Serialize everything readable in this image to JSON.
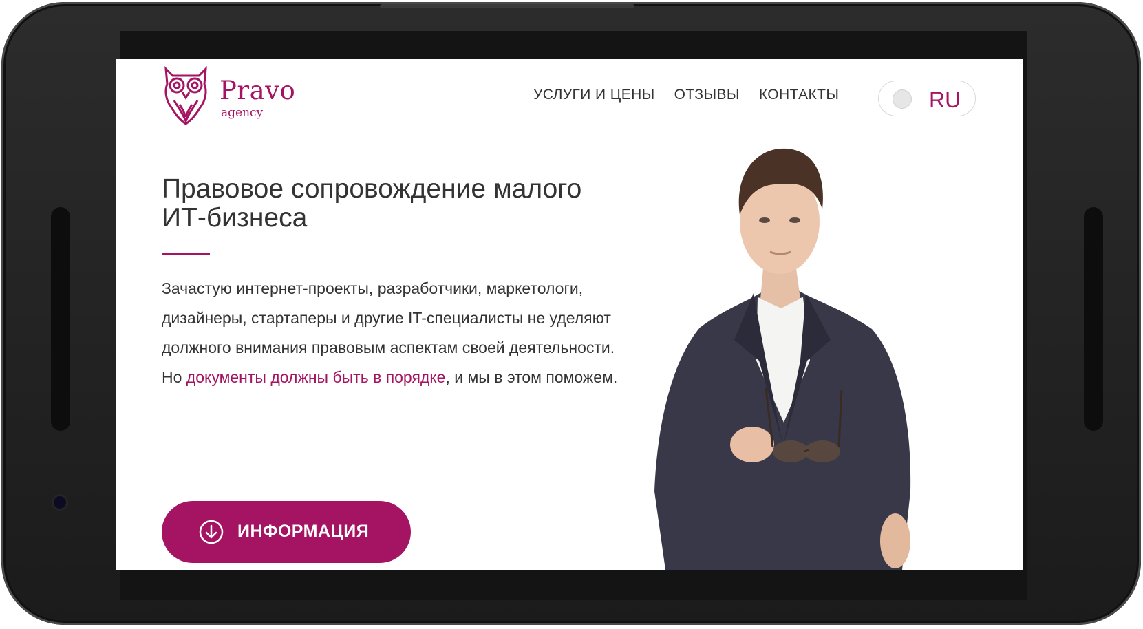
{
  "header": {
    "logo": {
      "name": "Pravo",
      "subtitle": "agency"
    },
    "nav": [
      {
        "label": "УСЛУГИ И ЦЕНЫ"
      },
      {
        "label": "ОТЗЫВЫ"
      },
      {
        "label": "КОНТАКТЫ"
      }
    ],
    "language": {
      "label": "RU"
    }
  },
  "hero": {
    "title": "Правовое сопровождение малого ИТ-бизнеса",
    "paragraph": "Зачастую интернет-проекты, разработчики, маркетологи, дизайнеры, стартаперы и другие IT-специалисты не уделяют должного внимания правовым аспектам своей деятельности.",
    "cta_prefix": "Но ",
    "cta_link": "документы должны быть в порядке",
    "cta_suffix": ", и мы в этом поможем.",
    "button_label": "ИНФОРМАЦИЯ"
  },
  "colors": {
    "accent": "#a51462",
    "text": "#333333",
    "phone_frame": "#222222"
  },
  "icons": {
    "logo": "owl-logo-icon",
    "button": "arrow-down-circle-icon"
  }
}
